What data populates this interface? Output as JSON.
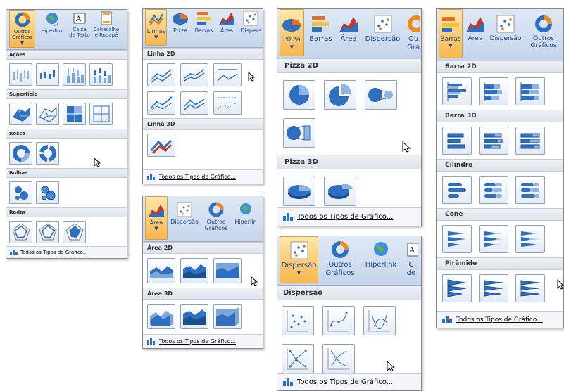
{
  "p1": {
    "ribbon": [
      "Outros\nGráficos",
      "Hiperlink",
      "Caixa\nde Texto",
      "Cabeçalho\ne Rodapé"
    ],
    "s1": "Ações",
    "s2": "Superfície",
    "s3": "Rosca",
    "s4": "Bolhas",
    "s5": "Radar",
    "footer": "Todos os Tipos de Gráfico..."
  },
  "p2": {
    "ribbon": [
      "Linhas",
      "Pizza",
      "Barras",
      "Área",
      "Dispers"
    ],
    "s1": "Linha 2D",
    "s2": "Linha 3D",
    "footer": "Todos os Tipos de Gráfico..."
  },
  "p3": {
    "ribbon": [
      "Área",
      "Dispersão",
      "Outros\nGráficos",
      "Hiperlin"
    ],
    "s1": "Área 2D",
    "s2": "Área 3D",
    "footer": "Todos os Tipos de Gráfico..."
  },
  "p4": {
    "ribbon": [
      "Pizza",
      "Barras",
      "Área",
      "Dispersão",
      "Ou\nGrá"
    ],
    "s1": "Pizza 2D",
    "s2": "Pizza 3D",
    "footer": "Todos os Tipos de Gráfico..."
  },
  "p5": {
    "ribbon": [
      "Dispersão",
      "Outros\nGráficos",
      "Hiperlink",
      "C\nde"
    ],
    "s1": "Dispersão",
    "footer": "Todos os Tipos de Gráfico..."
  },
  "p6": {
    "ribbon": [
      "Barras",
      "Área",
      "Dispersão",
      "Outros\nGráficos"
    ],
    "s1": "Barra 2D",
    "s2": "Barra 3D",
    "s3": "Cilindro",
    "s4": "Cone",
    "s5": "Pirâmide",
    "footer": "Todos os Tipos de Gráfico..."
  },
  "colors": {
    "accent": "#f9b54b",
    "blue": "#2e6fbf",
    "border": "#8aa1c0"
  }
}
